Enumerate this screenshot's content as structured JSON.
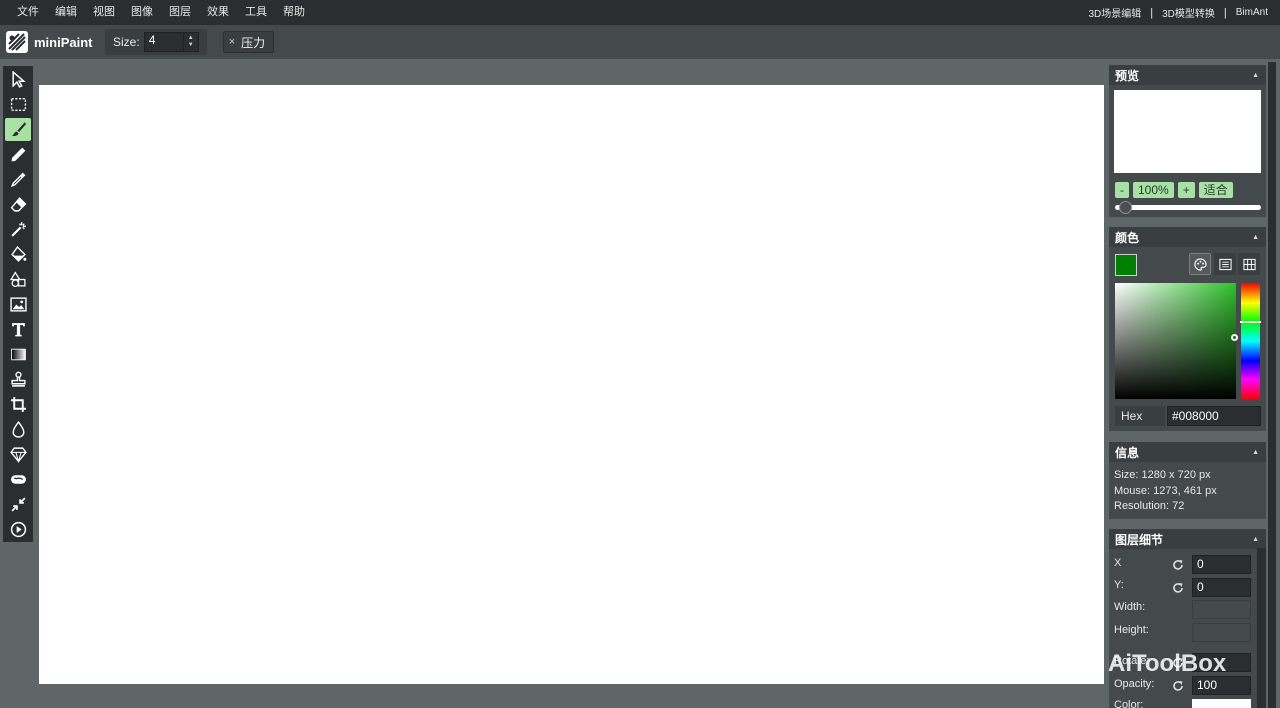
{
  "menu": {
    "items": [
      "文件",
      "编辑",
      "视图",
      "图像",
      "图层",
      "效果",
      "工具",
      "帮助"
    ],
    "right_links": [
      "3D场景编辑",
      "3D模型转换",
      "BimAnt"
    ],
    "separator": "|"
  },
  "toolbar": {
    "app_name": "miniPaint",
    "size_label": "Size:",
    "size_value": "4",
    "pressure_x": "×",
    "pressure_label": "压力"
  },
  "tools": [
    {
      "name": "select-icon",
      "active": false
    },
    {
      "name": "selection-rect-icon",
      "active": false
    },
    {
      "name": "brush-icon",
      "active": true
    },
    {
      "name": "pencil-icon",
      "active": false
    },
    {
      "name": "pick-color-icon",
      "active": false
    },
    {
      "name": "erase-icon",
      "active": false
    },
    {
      "name": "magic-wand-icon",
      "active": false
    },
    {
      "name": "fill-icon",
      "active": false
    },
    {
      "name": "shape-icon",
      "active": false
    },
    {
      "name": "media-icon",
      "active": false
    },
    {
      "name": "text-icon",
      "active": false
    },
    {
      "name": "gradient-icon",
      "active": false
    },
    {
      "name": "clone-icon",
      "active": false
    },
    {
      "name": "crop-icon",
      "active": false
    },
    {
      "name": "blur-icon",
      "active": false
    },
    {
      "name": "sharpen-icon",
      "active": false
    },
    {
      "name": "desaturate-icon",
      "active": false
    },
    {
      "name": "bulge-pinch-icon",
      "active": false
    },
    {
      "name": "animation-icon",
      "active": false
    }
  ],
  "preview": {
    "title": "预览",
    "zoom_minus": "-",
    "zoom_value": "100%",
    "zoom_plus": "+",
    "fit_label": "适合",
    "slider_level": 0.05
  },
  "color": {
    "title": "颜色",
    "swatch_color": "#008000",
    "hex_label": "Hex",
    "hex_value": "#008000"
  },
  "info": {
    "title": "信息",
    "size_line": "Size: 1280 x 720 px",
    "mouse_line": "Mouse: 1273, 461 px",
    "resolution_line": "Resolution: 72"
  },
  "details": {
    "title": "图层细节",
    "x_label": "X",
    "x_value": "0",
    "y_label": "Y:",
    "y_value": "0",
    "width_label": "Width:",
    "height_label": "Height:",
    "rotate_label": "Rotate:",
    "opacity_label": "Opacity:",
    "opacity_value": "100",
    "color_label": "Color:"
  },
  "watermark": {
    "text": "AiToolBox"
  },
  "colors": {
    "accent_green": "#a7e2a4",
    "menubar": "#2a2e30",
    "panel": "#44494b",
    "workspace": "#5f6668"
  }
}
